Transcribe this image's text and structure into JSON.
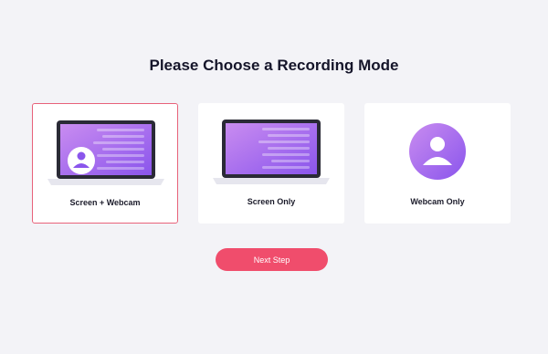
{
  "page": {
    "title": "Please Choose a Recording Mode"
  },
  "modes": [
    {
      "label": "Screen + Webcam",
      "icon": "laptop-webcam-icon",
      "selected": true
    },
    {
      "label": "Screen Only",
      "icon": "laptop-icon",
      "selected": false
    },
    {
      "label": "Webcam Only",
      "icon": "user-avatar-icon",
      "selected": false
    }
  ],
  "actions": {
    "next_label": "Next Step"
  },
  "colors": {
    "background": "#f3f3f7",
    "accent": "#f04d6c",
    "selected_border": "#e8627a",
    "gradient_start": "#c98cf0",
    "gradient_end": "#8a55ec"
  }
}
